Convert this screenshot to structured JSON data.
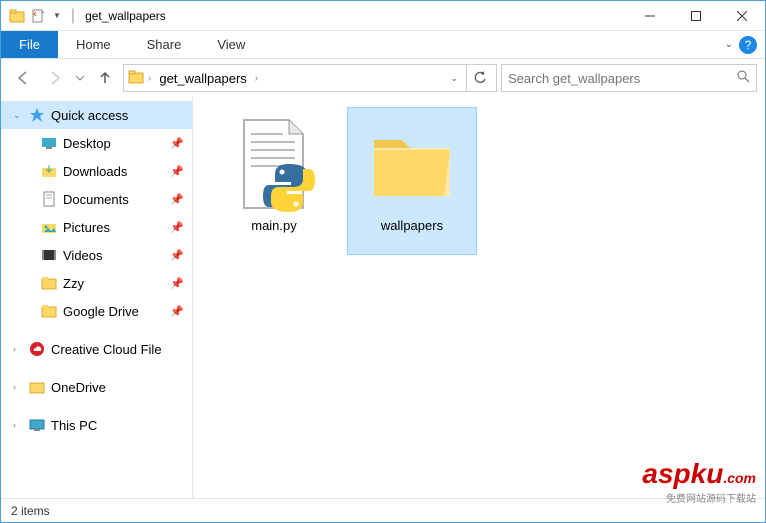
{
  "title": "get_wallpapers",
  "ribbon": {
    "file": "File",
    "home": "Home",
    "share": "Share",
    "view": "View"
  },
  "breadcrumb": [
    "get_wallpapers"
  ],
  "search": {
    "placeholder": "Search get_wallpapers"
  },
  "sidebar": {
    "quick_access": "Quick access",
    "items": [
      {
        "label": "Desktop",
        "pinned": true
      },
      {
        "label": "Downloads",
        "pinned": true
      },
      {
        "label": "Documents",
        "pinned": true
      },
      {
        "label": "Pictures",
        "pinned": true
      },
      {
        "label": "Videos",
        "pinned": true
      },
      {
        "label": "Zzy",
        "pinned": true
      },
      {
        "label": "Google Drive",
        "pinned": true
      }
    ],
    "cc": "Creative Cloud File",
    "onedrive": "OneDrive",
    "thispc": "This PC"
  },
  "files": {
    "items": [
      {
        "name": "main.py",
        "type": "python",
        "selected": false
      },
      {
        "name": "wallpapers",
        "type": "folder",
        "selected": true
      }
    ]
  },
  "status": "2 items",
  "watermark": {
    "main": "aspku",
    "sub": "免费网站源码下载站"
  }
}
